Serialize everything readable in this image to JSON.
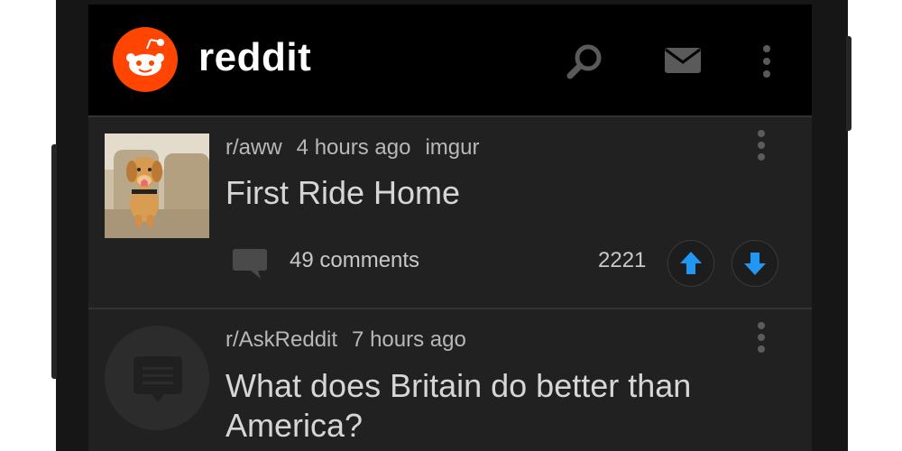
{
  "app": {
    "name": "reddit",
    "brand_color": "#ff4500",
    "icons": [
      "reddit-logo",
      "search-icon",
      "mail-icon",
      "more-vertical-icon"
    ]
  },
  "posts": [
    {
      "subreddit": "r/aww",
      "age": "4 hours ago",
      "domain": "imgur",
      "title": "First Ride Home",
      "comments": "49 comments",
      "score": "2221",
      "thumbnail": "puppy-in-car-seat",
      "vote_color": "#2196f3"
    },
    {
      "subreddit": "r/AskReddit",
      "age": "7 hours ago",
      "title": "What does Britain do better than America?",
      "thumbnail": "self-post-icon"
    }
  ]
}
